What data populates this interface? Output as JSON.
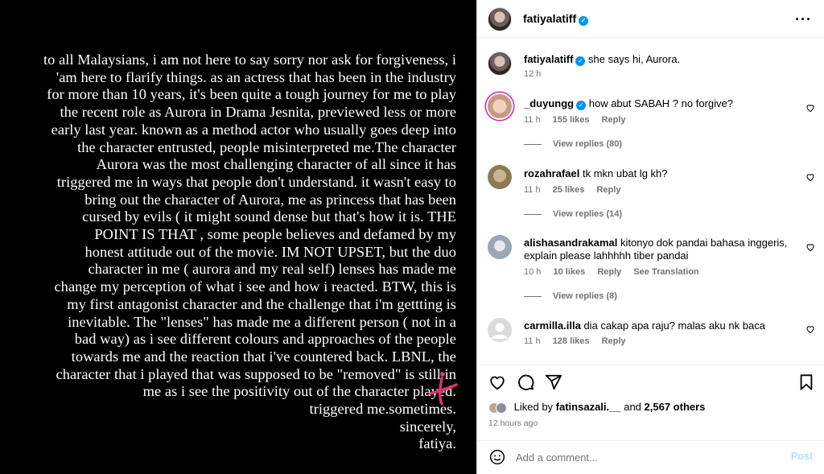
{
  "post_text_lines": [
    "to all Malaysians, i am not here to say sorry nor ask for forgiveness, i",
    "'am here to flarify things. as an actress that has been in the industry",
    "for more than 10 years, it's been quite a tough journey for me to play",
    "the recent role as Aurora in Drama Jesnita, previewed less or more",
    "early last year. known as a method actor who usually goes deep into",
    "the character entrusted, people misinterpreted me.The character",
    "Aurora was the most challenging character of all since it has",
    "triggered me in ways that people don't understand. it wasn't easy to",
    "bring out the character of Aurora, me as princess that has been",
    "cursed by evils ( it might sound dense but that's how it is.  THE",
    "POINT IS THAT , some people believes and defamed by my",
    "honest attitude out of the movie. IM NOT UPSET, but the duo",
    "character in me ( aurora and my real self) lenses has made me",
    "change my perception of what i see and how i reacted. BTW, this is",
    "my first antagonist character and the challenge that i'm gettting is",
    "inevitable. The \"lenses\" has made me a different person ( not in a",
    "bad way) as i see different colours and approaches of the people",
    "towards me and the reaction that i've countered back. LBNL, the",
    "character that i played that was supposed to be \"removed\" is still in",
    "me as i see the positivity out of the character played.",
    "triggered me.sometimes.",
    "sincerely,",
    "fatiya."
  ],
  "header": {
    "username": "fatiyalatiff",
    "more_icon": "more-horizontal-icon"
  },
  "caption": {
    "username": "fatiyalatiff",
    "text": "she says hi, Aurora.",
    "time": "12 h"
  },
  "comments": [
    {
      "username": "_duyungg",
      "verified": true,
      "text": "how abut SABAH ? no forgive?",
      "time": "11 h",
      "likes": "155 likes",
      "reply": "Reply",
      "view_replies": "View replies (80)"
    },
    {
      "username": "rozahrafael",
      "verified": false,
      "text": "tk mkn ubat lg kh?",
      "time": "11 h",
      "likes": "25 likes",
      "reply": "Reply",
      "view_replies": "View replies (14)"
    },
    {
      "username": "alishasandrakamal",
      "verified": false,
      "text": "kitonyo dok pandai bahasa inggeris, explain please lahhhhh tiber pandai",
      "time": "10 h",
      "likes": "10 likes",
      "reply": "Reply",
      "translation": "See Translation",
      "view_replies": "View replies (8)"
    },
    {
      "username": "carmilla.illa",
      "verified": false,
      "text": "dia cakap apa raju? malas aku nk baca",
      "time": "11 h",
      "likes": "128 likes",
      "reply": "Reply"
    }
  ],
  "likes": {
    "prefix": "Liked by ",
    "user": "fatinsazali.__",
    "mid": " and ",
    "count": "2,567 others"
  },
  "time_ago": "12 hours ago",
  "comment_box": {
    "placeholder": "Add a comment...",
    "post_label": "Post"
  },
  "colors": {
    "accent": "#0095f6",
    "post_disabled": "#b2dffc",
    "muted": "#737373",
    "media_bg": "#000000",
    "pink_mark": "#e0306f"
  }
}
